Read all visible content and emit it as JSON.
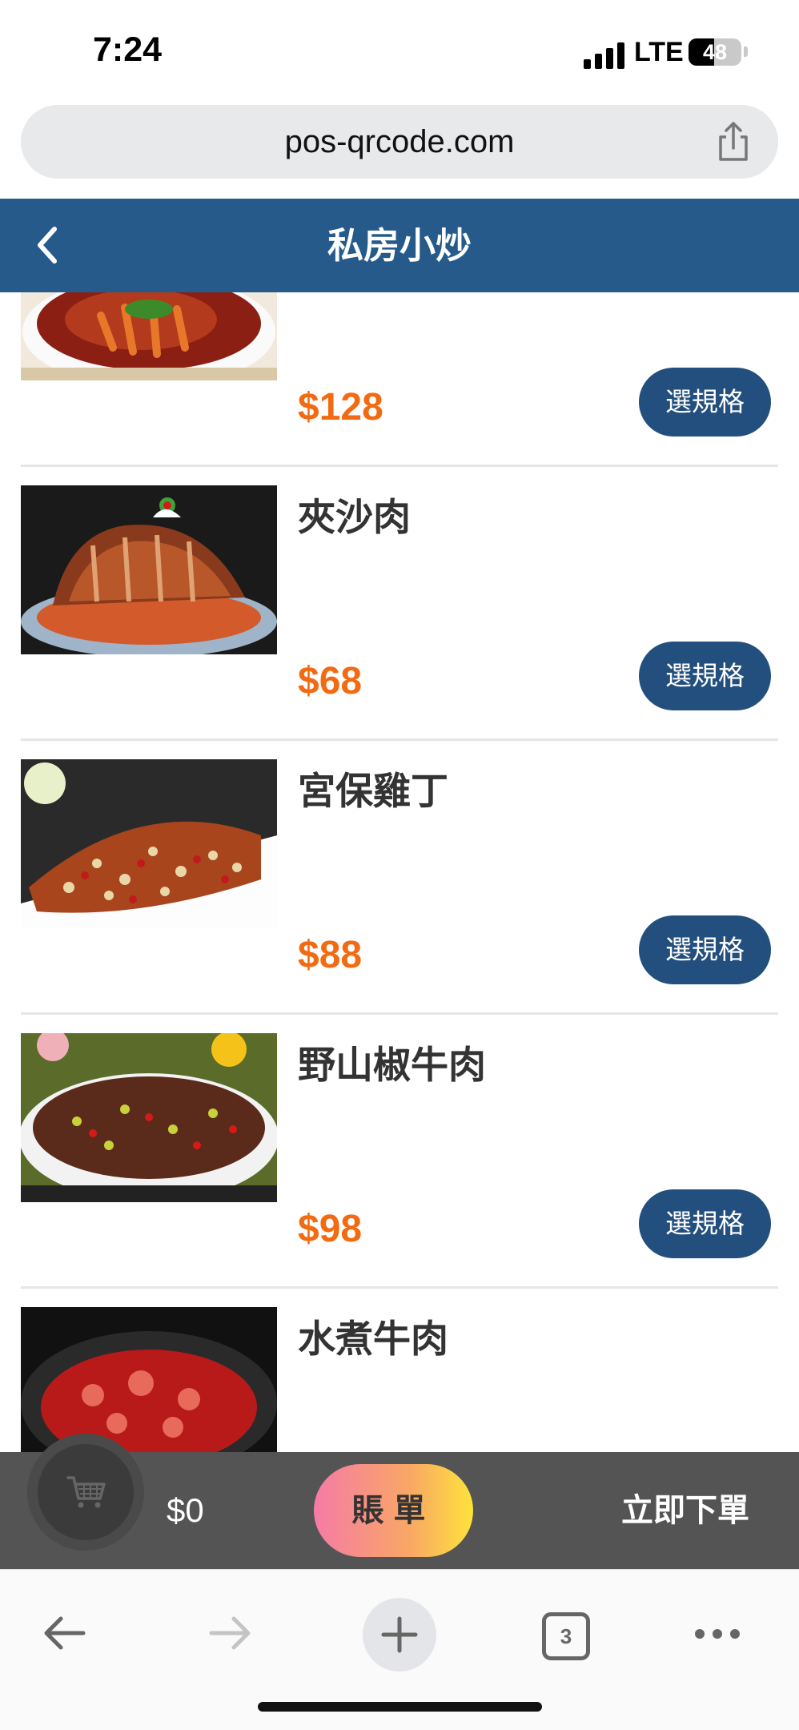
{
  "status_bar": {
    "time": "7:24",
    "network": "LTE",
    "battery": "48",
    "battery_level": 0.48
  },
  "url_bar": {
    "url": "pos-qrcode.com",
    "share_icon": "share-icon"
  },
  "header": {
    "title": "私房小炒",
    "back_icon": "chevron-left-icon",
    "background_color": "#265a8a"
  },
  "menu": {
    "items": [
      {
        "name": "",
        "price": "$128",
        "button_label": "選規格"
      },
      {
        "name": "夾沙肉",
        "price": "$68",
        "button_label": "選規格"
      },
      {
        "name": "宮保雞丁",
        "price": "$88",
        "button_label": "選規格"
      },
      {
        "name": "野山椒牛肉",
        "price": "$98",
        "button_label": "選規格"
      },
      {
        "name": "水煮牛肉",
        "price": "",
        "button_label": ""
      }
    ],
    "price_color": "#f26b12",
    "button_color": "#234f7e"
  },
  "order_bar": {
    "cart_icon": "shopping-cart-icon",
    "total": "$0",
    "bill_label": "賬單",
    "order_label": "立即下單"
  },
  "browser_toolbar": {
    "tab_count": "3",
    "icons": [
      "back-arrow-icon",
      "forward-arrow-icon",
      "plus-icon",
      "tabs-icon",
      "more-icon"
    ]
  }
}
